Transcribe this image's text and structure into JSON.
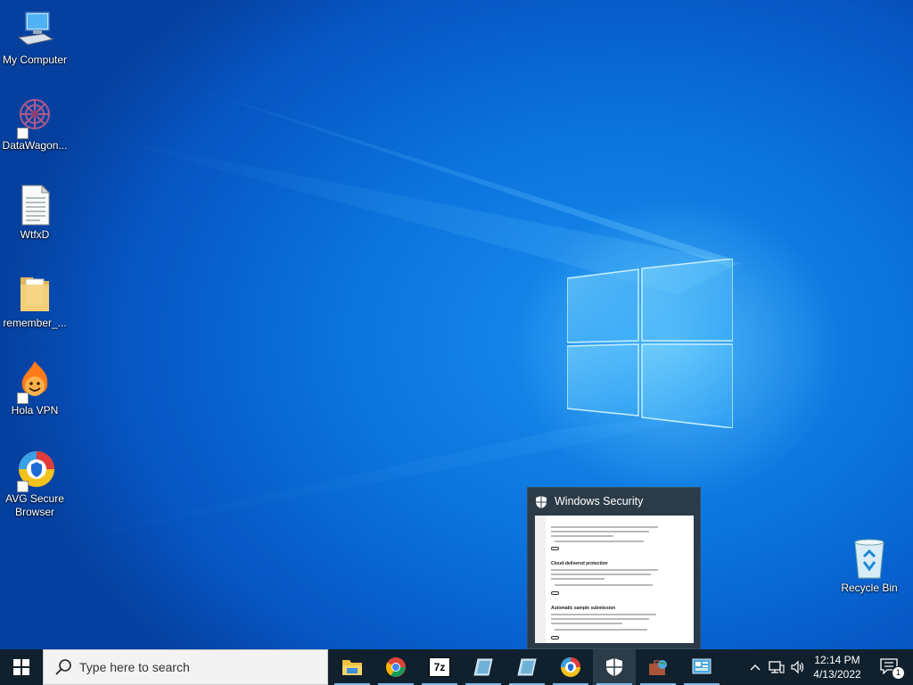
{
  "desktop": {
    "icons": [
      {
        "label": "My Computer",
        "icon": "computer-icon",
        "shortcut": false
      },
      {
        "label": "DataWagon...",
        "icon": "datawagon-icon",
        "shortcut": true
      },
      {
        "label": "WtfxD",
        "icon": "text-document-icon",
        "shortcut": false
      },
      {
        "label": "remember_...",
        "icon": "folder-icon",
        "shortcut": false
      },
      {
        "label": "Hola VPN",
        "icon": "hola-vpn-icon",
        "shortcut": true
      },
      {
        "label": "AVG Secure Browser",
        "icon": "avg-browser-icon",
        "shortcut": true
      }
    ],
    "recycle_bin": {
      "label": "Recycle Bin",
      "icon": "recycle-bin-icon"
    }
  },
  "thumbnail": {
    "title": "Windows Security",
    "preview_headings": [
      "Cloud-delivered protection",
      "Automatic sample submission"
    ],
    "toggle_state": "On"
  },
  "taskbar": {
    "search_placeholder": "Type here to search",
    "apps": [
      {
        "name": "File Explorer",
        "icon": "file-explorer-icon"
      },
      {
        "name": "Google Chrome",
        "icon": "chrome-icon"
      },
      {
        "name": "7-Zip",
        "icon": "7zip-icon",
        "text": "7z"
      },
      {
        "name": "Setup",
        "icon": "setup-icon"
      },
      {
        "name": "Setup",
        "icon": "setup-icon"
      },
      {
        "name": "AVG Secure Browser",
        "icon": "avg-browser-icon"
      },
      {
        "name": "Windows Security",
        "icon": "windows-security-icon"
      },
      {
        "name": "App",
        "icon": "briefcase-globe-icon"
      },
      {
        "name": "App",
        "icon": "control-panel-icon"
      }
    ],
    "clock": {
      "time": "12:14 PM",
      "date": "4/13/2022"
    },
    "notification_count": "1"
  },
  "colors": {
    "taskbar_bg": "#10202d",
    "wallpaper_blue": "#0b74dd",
    "accent": "#7fb9ea"
  }
}
